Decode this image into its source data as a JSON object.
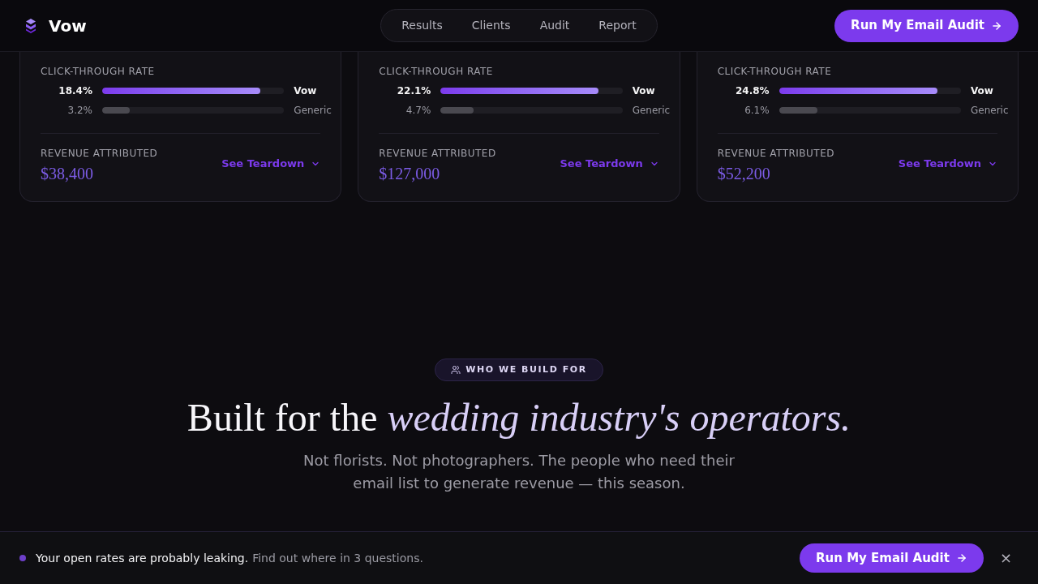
{
  "header": {
    "brand": "Vow",
    "nav": [
      {
        "label": "Results"
      },
      {
        "label": "Clients"
      },
      {
        "label": "Audit"
      },
      {
        "label": "Report"
      }
    ],
    "cta": "Run My Email Audit"
  },
  "cards": [
    {
      "metric_label": "CLICK-THROUGH RATE",
      "bars": [
        {
          "kind": "brand",
          "value": "18.4%",
          "level": 0.87,
          "label": "Vow"
        },
        {
          "kind": "generic",
          "value": "3.2%",
          "level": 0.15,
          "label": "Generic"
        }
      ],
      "revenue_label": "REVENUE ATTRIBUTED",
      "revenue": "$38,400",
      "link": "See Teardown"
    },
    {
      "metric_label": "CLICK-THROUGH RATE",
      "bars": [
        {
          "kind": "brand",
          "value": "22.1%",
          "level": 0.87,
          "label": "Vow"
        },
        {
          "kind": "generic",
          "value": "4.7%",
          "level": 0.18,
          "label": "Generic"
        }
      ],
      "revenue_label": "REVENUE ATTRIBUTED",
      "revenue": "$127,000",
      "link": "See Teardown"
    },
    {
      "metric_label": "CLICK-THROUGH RATE",
      "bars": [
        {
          "kind": "brand",
          "value": "24.8%",
          "level": 0.87,
          "label": "Vow"
        },
        {
          "kind": "generic",
          "value": "6.1%",
          "level": 0.21,
          "label": "Generic"
        }
      ],
      "revenue_label": "REVENUE ATTRIBUTED",
      "revenue": "$52,200",
      "link": "See Teardown"
    }
  ],
  "section": {
    "badge": "WHO WE BUILD FOR",
    "heading": "Built for the *wedding industry's operators.*",
    "subtitle": "Not florists. Not photographers. The people who need their email list to generate revenue — this season."
  },
  "banner": {
    "message": "Your open rates are probably leaking.",
    "hint": "Find out where in 3 questions.",
    "cta": "Run My Email Audit",
    "close": "×"
  }
}
